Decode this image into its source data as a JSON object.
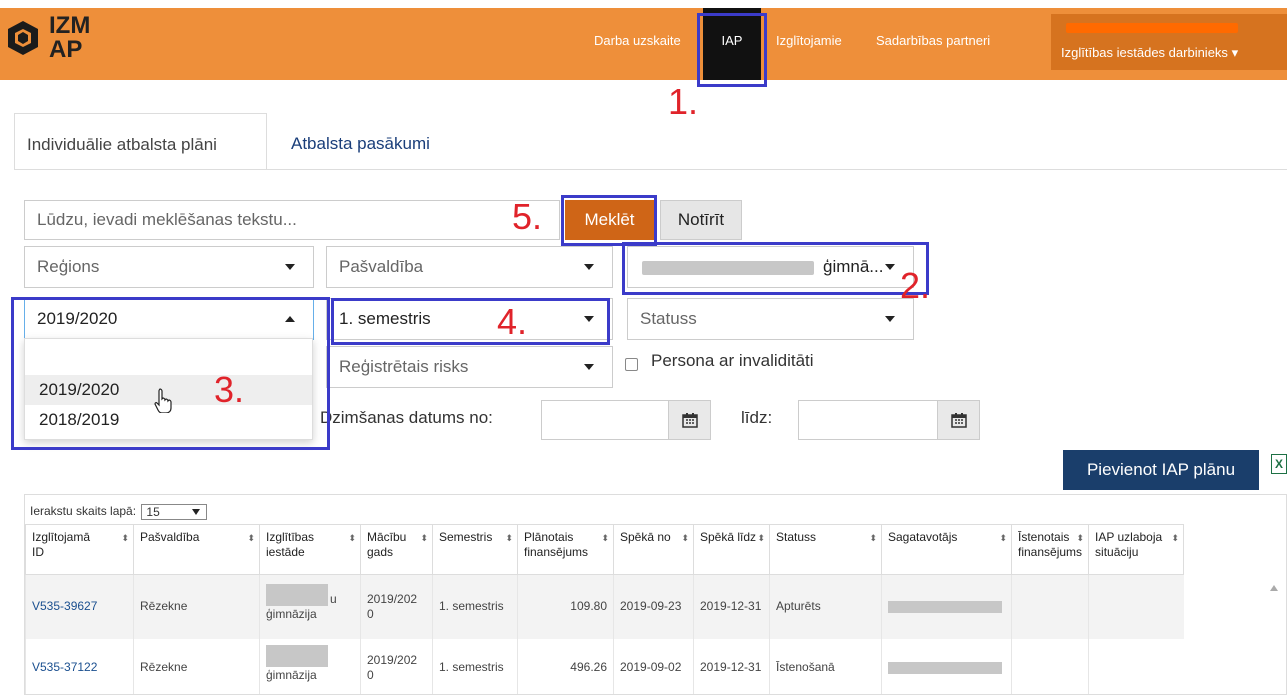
{
  "header": {
    "logo_line1": "IZM",
    "logo_line2": "AP",
    "nav": [
      "Darba uzskaite",
      "IAP",
      "Izglītojamie",
      "Sadarbības partneri"
    ],
    "active_nav": "IAP",
    "user_menu": "Izglītības iestādes darbinieks"
  },
  "tabs": [
    "Individuālie atbalsta plāni",
    "Atbalsta pasākumi"
  ],
  "filters": {
    "search_placeholder": "Lūdzu, ievadi meklēšanas tekstu...",
    "search_button": "Meklēt",
    "clear_button": "Notīrīt",
    "region_placeholder": "Reģions",
    "municipality_placeholder": "Pašvaldība",
    "school_suffix": "ģimnā...",
    "school_year_value": "2019/2020",
    "school_year_options": [
      "2019/2020",
      "2018/2019"
    ],
    "semester_value": "1. semestris",
    "status_placeholder": "Statuss",
    "risk_placeholder": "Reģistrētais risks",
    "disability_label": "Persona ar invaliditāti",
    "birthdate_from_label": "Dzimšanas datums no:",
    "birthdate_to_label": "līdz:"
  },
  "add_button": "Pievienot IAP plānu",
  "excel_icon_text": "X",
  "annotations": [
    "1.",
    "2.",
    "3.",
    "4.",
    "5."
  ],
  "grid": {
    "page_size_label": "Ierakstu skaits lapā:",
    "page_size_value": "15",
    "columns": [
      [
        "Izglītojamā",
        "ID"
      ],
      [
        "Pašvaldība",
        ""
      ],
      [
        "Izglītības",
        "iestāde"
      ],
      [
        "Mācību",
        "gads"
      ],
      [
        "Semestris",
        ""
      ],
      [
        "Plānotais",
        "finansējums"
      ],
      [
        "Spēkā no",
        ""
      ],
      [
        "Spēkā līdz",
        ""
      ],
      [
        "Statuss",
        ""
      ],
      [
        "Sagatavotājs",
        ""
      ],
      [
        "Īstenotais",
        "finansējums"
      ],
      [
        "IAP uzlaboja",
        "situāciju"
      ]
    ],
    "rows": [
      {
        "id": "V535-39627",
        "municipality": "Rēzekne",
        "school_tail": "u",
        "school": "ģimnāzija",
        "year1": "2019/202",
        "year2": "0",
        "semester": "1. semestris",
        "planned": "109.80",
        "from": "2019-09-23",
        "to": "2019-12-31",
        "status": "Apturēts"
      },
      {
        "id": "V535-37122",
        "municipality": "Rēzekne",
        "school_tail": "",
        "school": "ģimnāzija",
        "year1": "2019/202",
        "year2": "0",
        "semester": "1. semestris",
        "planned": "496.26",
        "from": "2019-09-02",
        "to": "2019-12-31",
        "status": "Īstenošanā"
      }
    ]
  },
  "colors": {
    "header_orange": "#ee8f3a",
    "search_button": "#cf6517",
    "add_button": "#1a3e6b",
    "highlight_box": "#3b3bc9",
    "annotation_red": "#e0232a"
  }
}
